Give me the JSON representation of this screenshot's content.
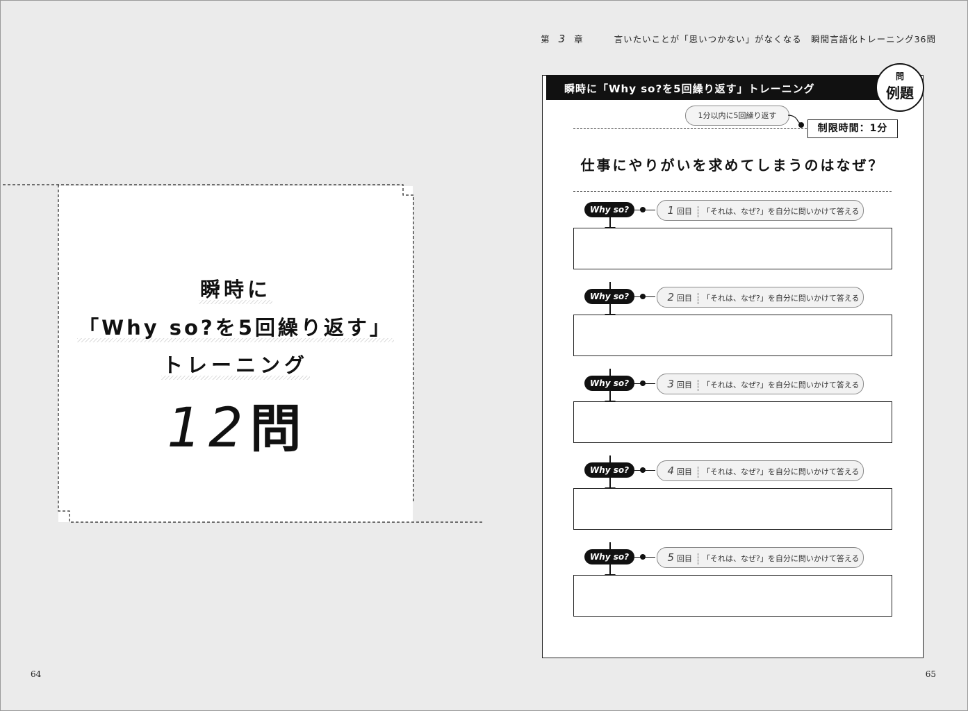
{
  "running_head": {
    "chapter_prefix": "第",
    "chapter_num": "3",
    "chapter_suffix": "章",
    "title": "言いたいことが「思いつかない」がなくなる　瞬間言語化トレーニング36問"
  },
  "page_numbers": {
    "left": "64",
    "right": "65"
  },
  "left_card": {
    "line1": "瞬時に",
    "line2": "「Why so?を5回繰り返す」",
    "line3": "トレーニング",
    "count_num": "12",
    "count_unit": "問"
  },
  "panel": {
    "title": "瞬時に「Why so?を5回繰り返す」トレーニング",
    "badge_top": "問",
    "badge_main": "例題",
    "time_hint": "1分以内に5回繰り返す",
    "time_limit": "制限時間：1分",
    "question": "仕事にやりがいを求めてしまうのはなぜ？",
    "steps": [
      {
        "tag": "Why so?",
        "num": "1",
        "unit": "回目",
        "prompt": "「それは、なぜ?」を自分に問いかけて答える"
      },
      {
        "tag": "Why so?",
        "num": "2",
        "unit": "回目",
        "prompt": "「それは、なぜ?」を自分に問いかけて答える"
      },
      {
        "tag": "Why so?",
        "num": "3",
        "unit": "回目",
        "prompt": "「それは、なぜ?」を自分に問いかけて答える"
      },
      {
        "tag": "Why so?",
        "num": "4",
        "unit": "回目",
        "prompt": "「それは、なぜ?」を自分に問いかけて答える"
      },
      {
        "tag": "Why so?",
        "num": "5",
        "unit": "回目",
        "prompt": "「それは、なぜ?」を自分に問いかけて答える"
      }
    ]
  }
}
